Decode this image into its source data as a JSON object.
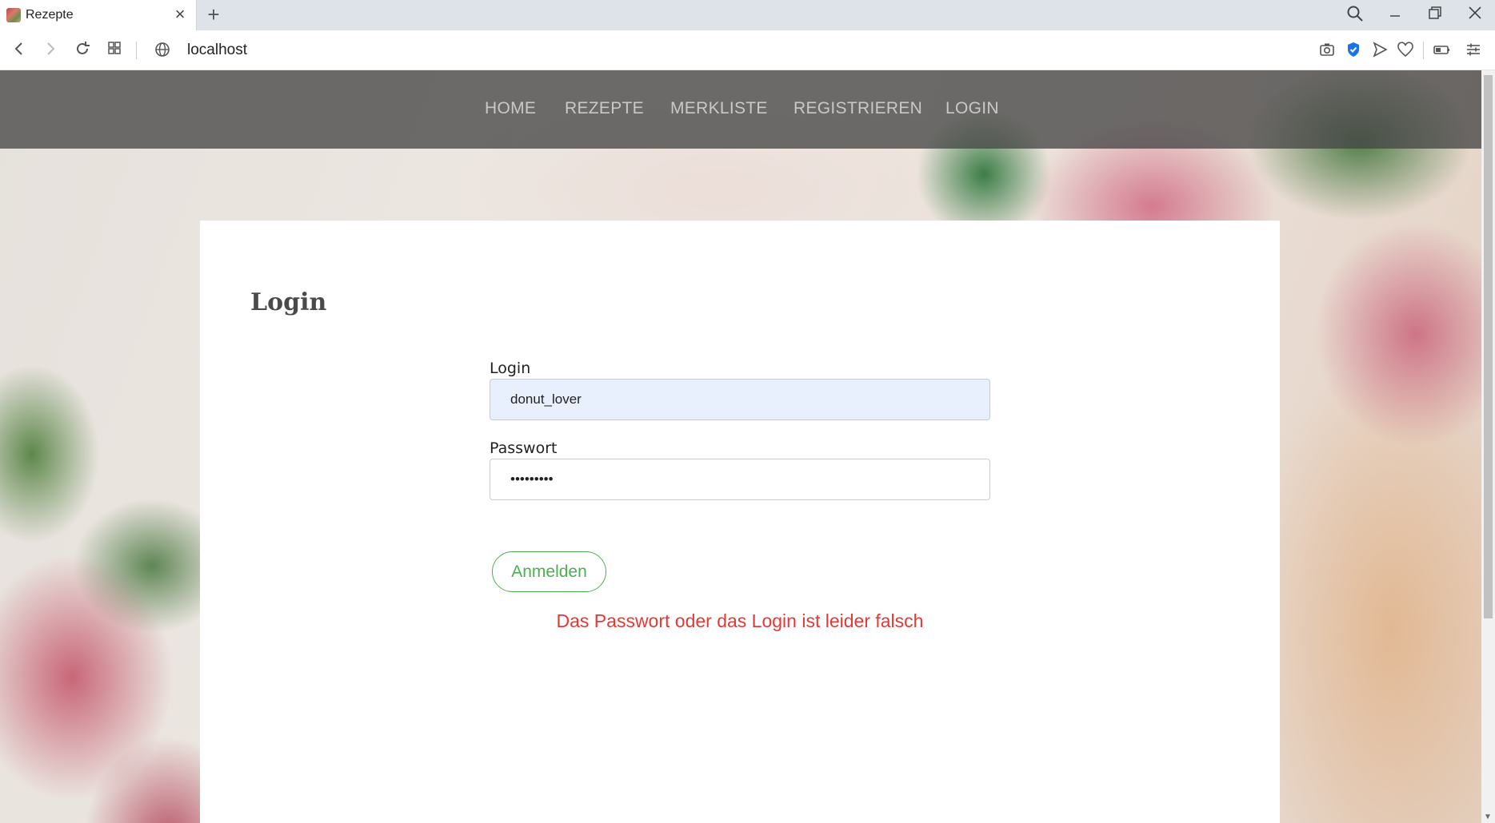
{
  "browser": {
    "tab": {
      "title": "Rezepte"
    },
    "url": "localhost"
  },
  "site": {
    "nav": [
      "HOME",
      "REZEPTE",
      "MERKLISTE",
      "REGISTRIEREN",
      "LOGIN"
    ]
  },
  "login": {
    "heading": "Login",
    "login_label": "Login",
    "login_value": "donut_lover",
    "password_label": "Passwort",
    "password_value": "•••••••••",
    "submit_label": "Anmelden",
    "error": "Das Passwort oder das Login ist leider falsch"
  },
  "colors": {
    "accent_green": "#4caf50",
    "error_red": "#e53935",
    "autofill_bg": "#e8f0fe"
  }
}
